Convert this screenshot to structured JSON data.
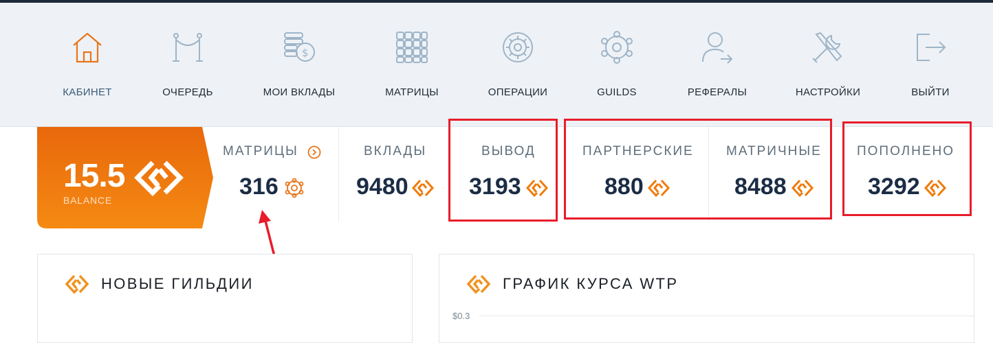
{
  "nav": {
    "items": [
      {
        "label": "КАБИНЕТ",
        "icon": "house-icon",
        "active": true
      },
      {
        "label": "ОЧЕРЕДЬ",
        "icon": "queue-barrier-icon"
      },
      {
        "label": "МОИ ВКЛАДЫ",
        "icon": "coins-dollar-icon"
      },
      {
        "label": "МАТРИЦЫ",
        "icon": "matrix-grid-icon"
      },
      {
        "label": "ОПЕРАЦИИ",
        "icon": "operations-gear-icon"
      },
      {
        "label": "GUILDS",
        "icon": "guilds-network-icon"
      },
      {
        "label": "РЕФЕРАЛЫ",
        "icon": "referral-user-icon"
      },
      {
        "label": "НАСТРОЙКИ",
        "icon": "settings-tools-icon"
      },
      {
        "label": "ВЫЙТИ",
        "icon": "logout-icon"
      }
    ]
  },
  "balance": {
    "value": "15.5",
    "label": "BALANCE"
  },
  "stats": {
    "matrices": {
      "label": "МАТРИЦЫ",
      "value": "316"
    },
    "deposits": {
      "label": "ВКЛАДЫ",
      "value": "9480"
    },
    "withdraw": {
      "label": "ВЫВОД",
      "value": "3193"
    },
    "partner": {
      "label": "ПАРТНЕРСКИЕ",
      "value": "880"
    },
    "matrix_income": {
      "label": "МАТРИЧНЫЕ",
      "value": "8488"
    },
    "replenished": {
      "label": "ПОПОЛНЕНО",
      "value": "3292"
    }
  },
  "panels": {
    "guilds": {
      "title": "НОВЫЕ ГИЛЬДИИ"
    },
    "chart": {
      "title": "ГРАФИК КУРСА WTP",
      "y_tick": "$0.3"
    }
  },
  "colors": {
    "accent": "#f07b0a",
    "highlight": "#e81c2a",
    "text_dark": "#1b2d45"
  }
}
